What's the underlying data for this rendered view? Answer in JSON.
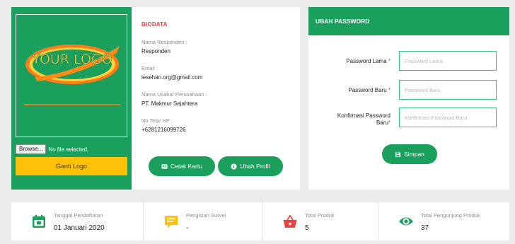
{
  "logo": {
    "text": "YOUR LOGO",
    "file_button": "Browse...",
    "file_status": "No file selected.",
    "change_button": "Ganti Logo"
  },
  "biodata": {
    "title": "BIODATA",
    "fields": [
      {
        "label": "Nama Responden :",
        "value": "Responden"
      },
      {
        "label": "Email :",
        "value": "lesehan.org@gmail.com"
      },
      {
        "label": "Nama Usaha/ Perusahaan :",
        "value": "PT. Makmur Sejahtera"
      },
      {
        "label": "No Telp/ HP :",
        "value": "+6281216099726"
      }
    ],
    "print_card_button": "Cetak Kartu",
    "edit_profile_button": "Ubah Profil"
  },
  "password": {
    "header": "UBAH PASSWORD",
    "old": {
      "label": "Password Lama",
      "placeholder": "Password Lama"
    },
    "new": {
      "label": "Password Baru",
      "placeholder": "Password Baru"
    },
    "confirm": {
      "label_line1": "Konfirmasi Password",
      "label_line2": "Baru",
      "placeholder": "Konfirmasi Password Baru"
    },
    "required_mark": "*",
    "save_button": "Simpan"
  },
  "stats": [
    {
      "label": "Tanggal Pendaftaran",
      "value": "01 Januari 2020",
      "icon": "calendar-icon",
      "color": "#1aa05c"
    },
    {
      "label": "Pengisian Survei",
      "value": "-",
      "icon": "survey-icon",
      "color": "#ffc107"
    },
    {
      "label": "Total Produk",
      "value": "5",
      "icon": "shopping-basket-icon",
      "color": "#e84343"
    },
    {
      "label": "Total Pengunjung Produk",
      "value": "37",
      "icon": "eye-icon",
      "color": "#1aa05c"
    }
  ],
  "colors": {
    "primary": "#1aa05c",
    "accent": "#ffc107",
    "danger": "#e84343",
    "background": "#ececec"
  }
}
